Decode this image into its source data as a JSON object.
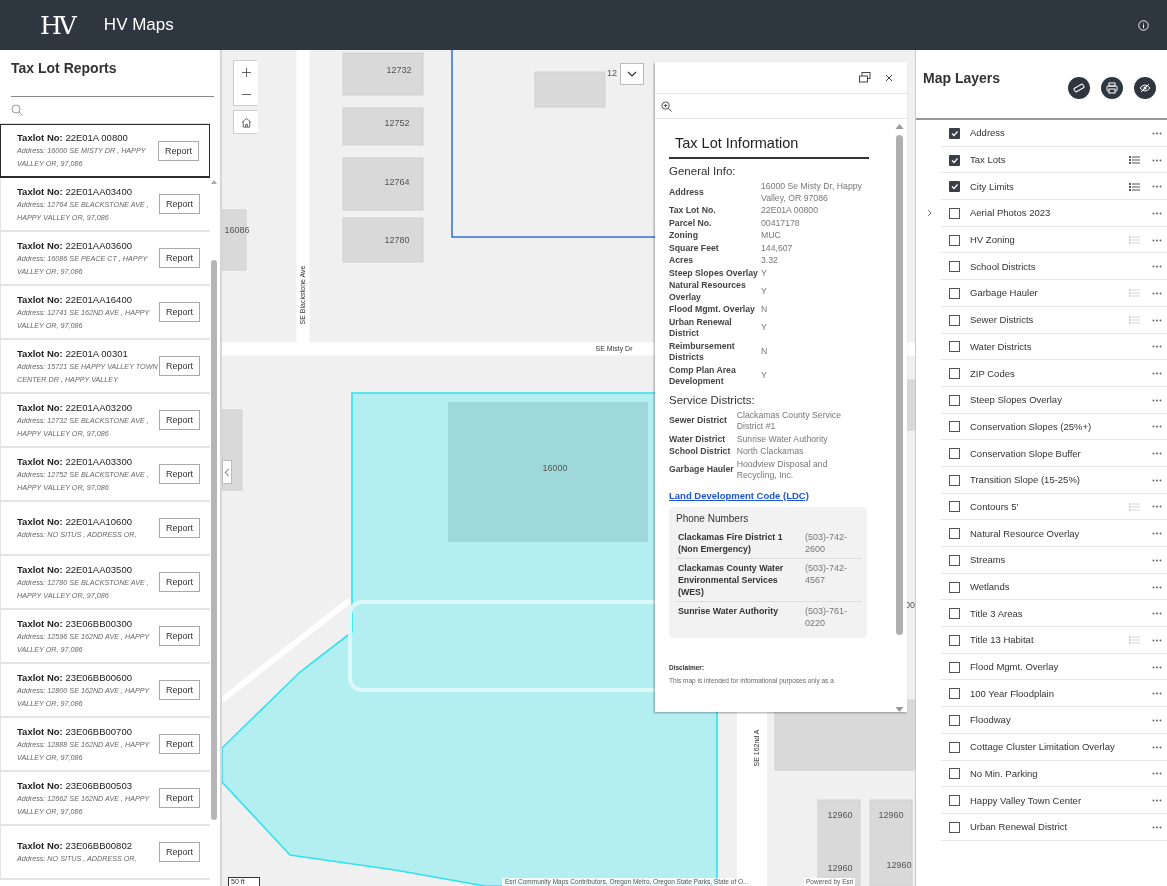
{
  "header": {
    "logo": "HV",
    "title": "HV Maps"
  },
  "reports": {
    "title": "Tax Lot Reports",
    "items": [
      {
        "taxlot": "**Taxlot No:** 22E01A 00800",
        "address": "Address: 16000 SE MISTY DR , HAPPY VALLEY  OR, 97,086",
        "button": "Report",
        "selected": true
      },
      {
        "taxlot": "**Taxlot No:** 22E01AA03400",
        "address": "Address: 12764 SE BLACKSTONE AVE , HAPPY VALLEY  OR, 97,086",
        "button": "Report",
        "selected": false
      },
      {
        "taxlot": "**Taxlot No:** 22E01AA03600",
        "address": "Address: 16086 SE PEACE CT , HAPPY VALLEY  OR, 97,086",
        "button": "Report",
        "selected": false
      },
      {
        "taxlot": "**Taxlot No:** 22E01AA16400",
        "address": "Address: 12741 SE 162ND AVE , HAPPY VALLEY  OR, 97,086",
        "button": "Report",
        "selected": false
      },
      {
        "taxlot": "**Taxlot No:** 22E01A 00301",
        "address": "Address: 15721 SE HAPPY VALLEY TOWN CENTER DR , HAPPY VALLEY",
        "button": "Report",
        "selected": false
      },
      {
        "taxlot": "**Taxlot No:** 22E01AA03200",
        "address": "Address: 12732 SE BLACKSTONE AVE , HAPPY VALLEY  OR, 97,086",
        "button": "Report",
        "selected": false
      },
      {
        "taxlot": "**Taxlot No:** 22E01AA03300",
        "address": "Address: 12752 SE BLACKSTONE AVE , HAPPY VALLEY  OR, 97,086",
        "button": "Report",
        "selected": false
      },
      {
        "taxlot": "**Taxlot No:** 22E01AA10600",
        "address": "Address: NO SITUS , ADDRESS OR,",
        "button": "Report",
        "selected": false
      },
      {
        "taxlot": "**Taxlot No:** 22E01AA03500",
        "address": "Address: 12780 SE BLACKSTONE AVE , HAPPY VALLEY  OR, 97,086",
        "button": "Report",
        "selected": false
      },
      {
        "taxlot": "**Taxlot No:** 23E06BB00300",
        "address": "Address: 12596 SE 162ND AVE , HAPPY VALLEY  OR, 97,086",
        "button": "Report",
        "selected": false
      },
      {
        "taxlot": "**Taxlot No:** 23E06BB00600",
        "address": "Address: 12800 SE 162ND AVE , HAPPY VALLEY  OR, 97,086",
        "button": "Report",
        "selected": false
      },
      {
        "taxlot": "**Taxlot No:** 23E06BB00700",
        "address": "Address: 12888 SE 162ND AVE , HAPPY VALLEY  OR, 97,086",
        "button": "Report",
        "selected": false
      },
      {
        "taxlot": "**Taxlot No:** 23E06BB00503",
        "address": "Address: 12662 SE 162ND AVE , HAPPY VALLEY  OR, 97,086",
        "button": "Report",
        "selected": false
      },
      {
        "taxlot": "**Taxlot No:** 23E06BB00802",
        "address": "Address: NO SITUS , ADDRESS OR,",
        "button": "Report",
        "selected": false
      }
    ]
  },
  "map": {
    "labels": [
      {
        "text": "12732",
        "kind": "lot"
      },
      {
        "text": "12752",
        "kind": "lot"
      },
      {
        "text": "12764",
        "kind": "lot"
      },
      {
        "text": "12780",
        "kind": "lot"
      },
      {
        "text": "16086",
        "kind": "lot"
      },
      {
        "text": "12",
        "kind": "lot"
      },
      {
        "text": "SE Blackstone Ave",
        "kind": "street_vertical"
      },
      {
        "text": "SE Misty Dr",
        "kind": "street"
      },
      {
        "text": "16000",
        "kind": "lot"
      },
      {
        "text": "SE 162nd A",
        "kind": "street_vertical"
      },
      {
        "text": "00",
        "kind": "lot"
      },
      {
        "text": "12960",
        "kind": "lot"
      },
      {
        "text": "12960",
        "kind": "lot"
      },
      {
        "text": "12960",
        "kind": "lot"
      },
      {
        "text": "12960",
        "kind": "lot"
      }
    ],
    "scale": "50 ft",
    "attribution": "Esri Community Maps Contributors, Oregon Metro, Oregon State Parks, State of O...",
    "powered_by": "Powered by Esri"
  },
  "popup": {
    "title": "Tax Lot Information",
    "general_heading": "General Info:",
    "general": [
      {
        "label": "Address",
        "value": "16000 Se Misty Dr, Happy Valley, OR 97086"
      },
      {
        "label": "Tax Lot No.",
        "value": "22E01A 00800"
      },
      {
        "label": "Parcel No.",
        "value": "00417178"
      },
      {
        "label": "Zoning",
        "value": "MUC"
      },
      {
        "label": "Square Feet",
        "value": "144,607"
      },
      {
        "label": "Acres",
        "value": "3.32"
      },
      {
        "label": "Steep Slopes Overlay",
        "value": "Y"
      },
      {
        "label": "Natural Resources Overlay",
        "value": "Y"
      },
      {
        "label": "Flood Mgmt. Overlay",
        "value": "N"
      },
      {
        "label": "Urban Renewal District",
        "value": "Y"
      },
      {
        "label": "Reimbursement Districts",
        "value": "N"
      },
      {
        "label": "Comp Plan Area Development",
        "value": "Y"
      }
    ],
    "service_heading": "Service Districts:",
    "service": [
      {
        "label": "Sewer District",
        "value": "Clackamas County Service District #1"
      },
      {
        "label": "Water District",
        "value": "Sunrise Water Authority"
      },
      {
        "label": "School District",
        "value": "North Clackamas"
      },
      {
        "label": "Garbage Hauler",
        "value": "Hoodview Disposal and Recycling, Inc."
      }
    ],
    "link": "Land Development Code (LDC)",
    "phones": {
      "title": "Phone Numbers",
      "rows": [
        {
          "name": "Clackamas Fire District 1 (Non Emergency)",
          "number": "(503)-742-2600"
        },
        {
          "name": "Clackamas County Water Environmental Services (WES)",
          "number": "(503)-742-4567"
        },
        {
          "name": "Sunrise Water Authority",
          "number": "(503)-761-0220"
        }
      ]
    },
    "disclaimer_heading": "Disclaimer:",
    "disclaimer": "This map is intended for informational purposes only as a"
  },
  "layers": {
    "title": "Map Layers",
    "items": [
      {
        "label": "Address",
        "checked": true,
        "legend": false,
        "expandable": false
      },
      {
        "label": "Tax Lots",
        "checked": true,
        "legend": true,
        "expandable": false
      },
      {
        "label": "City Limits",
        "checked": true,
        "legend": true,
        "expandable": false
      },
      {
        "label": "Aerial Photos 2023",
        "checked": false,
        "legend": false,
        "expandable": true
      },
      {
        "label": "HV Zoning",
        "checked": false,
        "legend": true,
        "expandable": false
      },
      {
        "label": "School Districts",
        "checked": false,
        "legend": false,
        "expandable": false
      },
      {
        "label": "Garbage Hauler",
        "checked": false,
        "legend": true,
        "expandable": false
      },
      {
        "label": "Sewer Districts",
        "checked": false,
        "legend": true,
        "expandable": false
      },
      {
        "label": "Water Districts",
        "checked": false,
        "legend": false,
        "expandable": false
      },
      {
        "label": "ZIP Codes",
        "checked": false,
        "legend": false,
        "expandable": false
      },
      {
        "label": "Steep Slopes Overlay",
        "checked": false,
        "legend": false,
        "expandable": false
      },
      {
        "label": "Conservation Slopes (25%+)",
        "checked": false,
        "legend": false,
        "expandable": false
      },
      {
        "label": "Conservation Slope Buffer",
        "checked": false,
        "legend": false,
        "expandable": false
      },
      {
        "label": "Transition Slope (15-25%)",
        "checked": false,
        "legend": false,
        "expandable": false
      },
      {
        "label": "Contours 5'",
        "checked": false,
        "legend": true,
        "expandable": false
      },
      {
        "label": "Natural Resource Overlay",
        "checked": false,
        "legend": false,
        "expandable": false
      },
      {
        "label": "Streams",
        "checked": false,
        "legend": false,
        "expandable": false
      },
      {
        "label": "Wetlands",
        "checked": false,
        "legend": false,
        "expandable": false
      },
      {
        "label": "Title 3 Areas",
        "checked": false,
        "legend": false,
        "expandable": false
      },
      {
        "label": "Title 13 Habitat",
        "checked": false,
        "legend": true,
        "expandable": false
      },
      {
        "label": "Flood Mgmt. Overlay",
        "checked": false,
        "legend": false,
        "expandable": false
      },
      {
        "label": "100 Year Floodplain",
        "checked": false,
        "legend": false,
        "expandable": false
      },
      {
        "label": "Floodway",
        "checked": false,
        "legend": false,
        "expandable": false
      },
      {
        "label": "Cottage Cluster Limitation Overlay",
        "checked": false,
        "legend": false,
        "expandable": false
      },
      {
        "label": "No Min. Parking",
        "checked": false,
        "legend": false,
        "expandable": false
      },
      {
        "label": "Happy Valley Town Center",
        "checked": false,
        "legend": false,
        "expandable": false
      },
      {
        "label": "Urban Renewal District",
        "checked": false,
        "legend": false,
        "expandable": false
      }
    ]
  }
}
